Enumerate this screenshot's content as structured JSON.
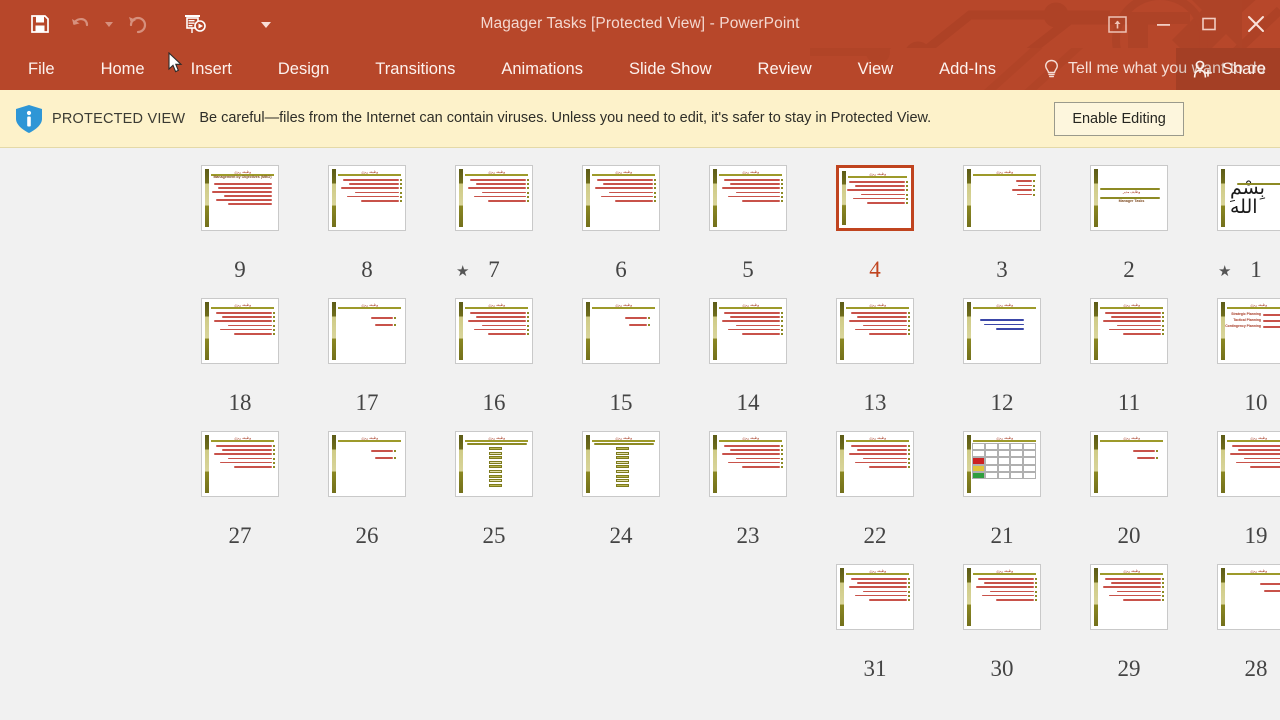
{
  "window": {
    "title": "Magager Tasks [Protected View] - PowerPoint",
    "theme_color": "#b7472a",
    "accent_selected": "#c0441f"
  },
  "quick_access": {
    "items": [
      {
        "name": "save-icon",
        "label": "Save",
        "enabled": true
      },
      {
        "name": "undo-icon",
        "label": "Undo",
        "enabled": false
      },
      {
        "name": "undo-dropdown-icon",
        "label": "Undo options",
        "enabled": false
      },
      {
        "name": "redo-icon",
        "label": "Redo",
        "enabled": false
      },
      {
        "name": "start-slideshow-icon",
        "label": "Start From Beginning",
        "enabled": true
      },
      {
        "name": "qat-customize-icon",
        "label": "Customize Quick Access Toolbar",
        "enabled": true
      }
    ]
  },
  "window_controls": [
    {
      "name": "ribbon-display-options-icon",
      "label": "Ribbon Display Options"
    },
    {
      "name": "minimize-icon",
      "label": "Minimize"
    },
    {
      "name": "maximize-icon",
      "label": "Restore Down"
    },
    {
      "name": "close-icon",
      "label": "Close"
    }
  ],
  "ribbon": {
    "tabs": [
      {
        "label": "File",
        "active": false
      },
      {
        "label": "Home",
        "active": false
      },
      {
        "label": "Insert",
        "active": false
      },
      {
        "label": "Design",
        "active": false
      },
      {
        "label": "Transitions",
        "active": false
      },
      {
        "label": "Animations",
        "active": false
      },
      {
        "label": "Slide Show",
        "active": false
      },
      {
        "label": "Review",
        "active": false
      },
      {
        "label": "View",
        "active": false
      },
      {
        "label": "Add-Ins",
        "active": false
      }
    ],
    "tell_me": "Tell me what you want to do",
    "share_label": "Share"
  },
  "protected_view": {
    "badge": "PROTECTED VIEW",
    "message": "Be careful—files from the Internet can contain viruses. Unless you need to edit, it's safer to stay in Protected View.",
    "button": "Enable Editing",
    "background": "#fdf2ca"
  },
  "slide_sorter": {
    "selected_slide": 4,
    "rows": [
      {
        "slides": [
          {
            "number": "9",
            "starred": false,
            "selected": false,
            "kind": "title-bullets",
            "title_en": "Management by Objectives (MBO)"
          },
          {
            "number": "8",
            "starred": false,
            "selected": false,
            "kind": "title-bullets"
          },
          {
            "number": "7",
            "starred": true,
            "selected": false,
            "kind": "title-bullets"
          },
          {
            "number": "6",
            "starred": false,
            "selected": false,
            "kind": "title-bullets"
          },
          {
            "number": "5",
            "starred": false,
            "selected": false,
            "kind": "title-bullets"
          },
          {
            "number": "4",
            "starred": false,
            "selected": true,
            "kind": "title-bullets"
          },
          {
            "number": "3",
            "starred": false,
            "selected": false,
            "kind": "title-right"
          },
          {
            "number": "2",
            "starred": false,
            "selected": false,
            "kind": "cover",
            "title_en": "Manager Tasks"
          },
          {
            "number": "1",
            "starred": true,
            "selected": false,
            "kind": "calligraphy"
          }
        ]
      },
      {
        "slides": [
          {
            "number": "18",
            "starred": false,
            "selected": false,
            "kind": "title-bullets"
          },
          {
            "number": "17",
            "starred": false,
            "selected": false,
            "kind": "title-sparse"
          },
          {
            "number": "16",
            "starred": false,
            "selected": false,
            "kind": "title-bullets"
          },
          {
            "number": "15",
            "starred": false,
            "selected": false,
            "kind": "title-sparse"
          },
          {
            "number": "14",
            "starred": false,
            "selected": false,
            "kind": "title-bullets"
          },
          {
            "number": "13",
            "starred": false,
            "selected": false,
            "kind": "title-bullets"
          },
          {
            "number": "12",
            "starred": false,
            "selected": false,
            "kind": "blue-text"
          },
          {
            "number": "11",
            "starred": false,
            "selected": false,
            "kind": "title-bullets"
          },
          {
            "number": "10",
            "starred": false,
            "selected": false,
            "kind": "planning",
            "lines_en": [
              "Strategic Planning",
              "Tactical Planning",
              "Contingency Planning"
            ]
          }
        ]
      },
      {
        "slides": [
          {
            "number": "27",
            "starred": false,
            "selected": false,
            "kind": "title-bullets"
          },
          {
            "number": "26",
            "starred": false,
            "selected": false,
            "kind": "title-sparse"
          },
          {
            "number": "25",
            "starred": false,
            "selected": false,
            "kind": "blocks"
          },
          {
            "number": "24",
            "starred": false,
            "selected": false,
            "kind": "blocks"
          },
          {
            "number": "23",
            "starred": false,
            "selected": false,
            "kind": "title-bullets"
          },
          {
            "number": "22",
            "starred": false,
            "selected": false,
            "kind": "title-bullets"
          },
          {
            "number": "21",
            "starred": false,
            "selected": false,
            "kind": "table"
          },
          {
            "number": "20",
            "starred": false,
            "selected": false,
            "kind": "title-sparse"
          },
          {
            "number": "19",
            "starred": false,
            "selected": false,
            "kind": "title-bullets"
          }
        ]
      },
      {
        "slides": [
          {
            "number": "31",
            "starred": false,
            "selected": false,
            "kind": "title-bullets"
          },
          {
            "number": "30",
            "starred": false,
            "selected": false,
            "kind": "title-bullets"
          },
          {
            "number": "29",
            "starred": false,
            "selected": false,
            "kind": "title-bullets"
          },
          {
            "number": "28",
            "starred": false,
            "selected": false,
            "kind": "title-sparse"
          }
        ]
      }
    ]
  }
}
